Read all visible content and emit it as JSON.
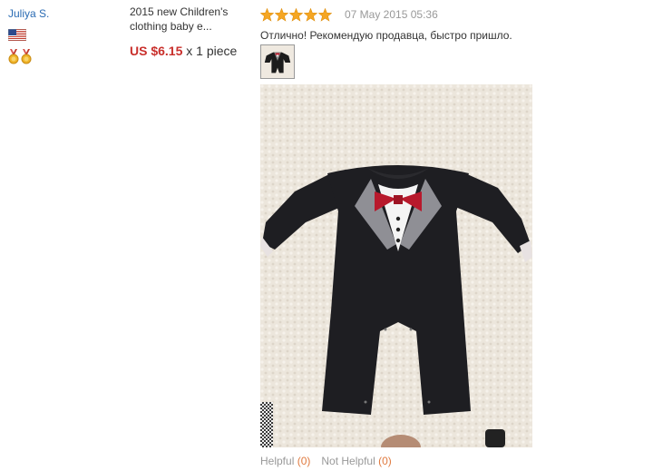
{
  "buyer": {
    "name": "Juliya S.",
    "country_flag": "us-flag-icon",
    "medals": [
      "medal-icon",
      "medal-icon"
    ]
  },
  "product": {
    "name": "2015 new Children's clothing baby e...",
    "price": "US $6.15",
    "quantity": "x 1 piece",
    "price_color": "#c9302c"
  },
  "review": {
    "rating": 5,
    "rating_max": 5,
    "date": "07 May 2015 05:36",
    "text": "Отлично! Рекомендую продавца, быстро пришло.",
    "star_color": "#f5a623"
  },
  "feedback": {
    "helpful_label": "Helpful",
    "helpful_count": "(0)",
    "not_helpful_label": "Not Helpful",
    "not_helpful_count": "(0)",
    "count_color": "#e07a3f"
  }
}
